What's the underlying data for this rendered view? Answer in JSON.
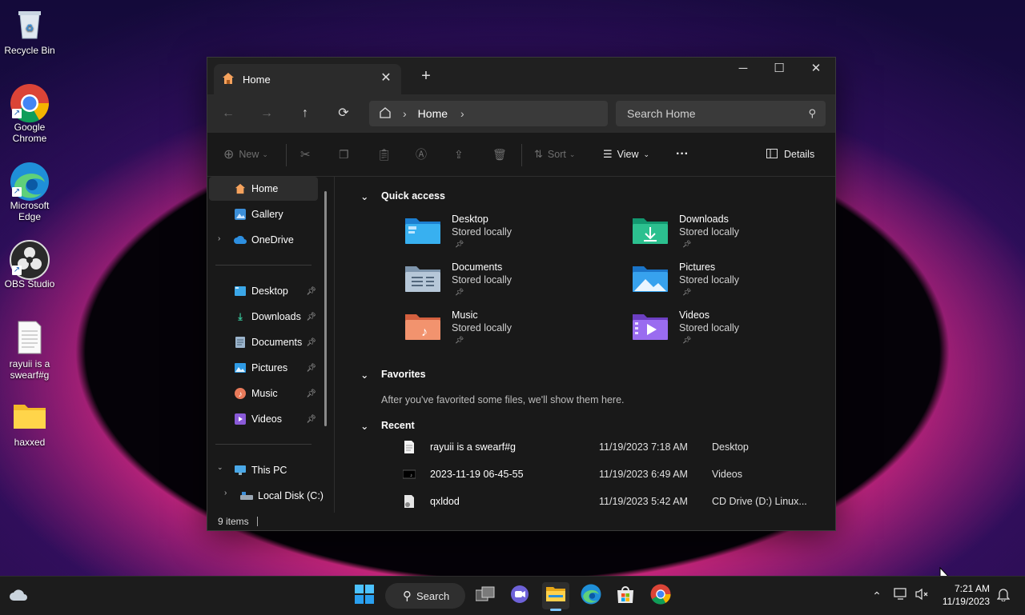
{
  "desktop": {
    "icons": [
      {
        "label": "Recycle Bin",
        "icon": "recycle-bin-icon"
      },
      {
        "label_line1": "Google",
        "label_line2": "Chrome",
        "icon": "chrome-icon"
      },
      {
        "label_line1": "Microsoft",
        "label_line2": "Edge",
        "icon": "edge-icon"
      },
      {
        "label": "OBS Studio",
        "icon": "obs-icon"
      },
      {
        "label_line1": "rayuii is a",
        "label_line2": "swearf#g",
        "icon": "text-file-icon"
      },
      {
        "label": "haxxed",
        "icon": "folder-icon"
      }
    ]
  },
  "explorer": {
    "tab_title": "Home",
    "new_tab_glyph": "+",
    "breadcrumb": [
      "Home"
    ],
    "search_placeholder": "Search Home",
    "commands": {
      "new": "New",
      "sort": "Sort",
      "view": "View",
      "more": "···",
      "details": "Details"
    },
    "sidebar": {
      "top": [
        "Home",
        "Gallery",
        "OneDrive"
      ],
      "pinned": [
        "Desktop",
        "Downloads",
        "Documents",
        "Pictures",
        "Music",
        "Videos"
      ],
      "this_pc": "This PC",
      "local_disk": "Local Disk (C:)"
    },
    "quick_access": {
      "heading": "Quick access",
      "items": [
        {
          "name": "Desktop",
          "sub": "Stored locally"
        },
        {
          "name": "Downloads",
          "sub": "Stored locally"
        },
        {
          "name": "Documents",
          "sub": "Stored locally"
        },
        {
          "name": "Pictures",
          "sub": "Stored locally"
        },
        {
          "name": "Music",
          "sub": "Stored locally"
        },
        {
          "name": "Videos",
          "sub": "Stored locally"
        }
      ]
    },
    "favorites": {
      "heading": "Favorites",
      "empty_note": "After you've favorited some files, we'll show them here."
    },
    "recent": {
      "heading": "Recent",
      "rows": [
        {
          "name": "rayuii is a swearf#g",
          "date": "11/19/2023 7:18 AM",
          "location": "Desktop"
        },
        {
          "name": "2023-11-19 06-45-55",
          "date": "11/19/2023 6:49 AM",
          "location": "Videos"
        },
        {
          "name": "qxldod",
          "date": "11/19/2023 5:42 AM",
          "location": "CD Drive (D:) Linux..."
        }
      ]
    },
    "status": {
      "items": "9 items"
    }
  },
  "taskbar": {
    "search_label": "Search",
    "time": "7:21 AM",
    "date": "11/19/2023"
  }
}
